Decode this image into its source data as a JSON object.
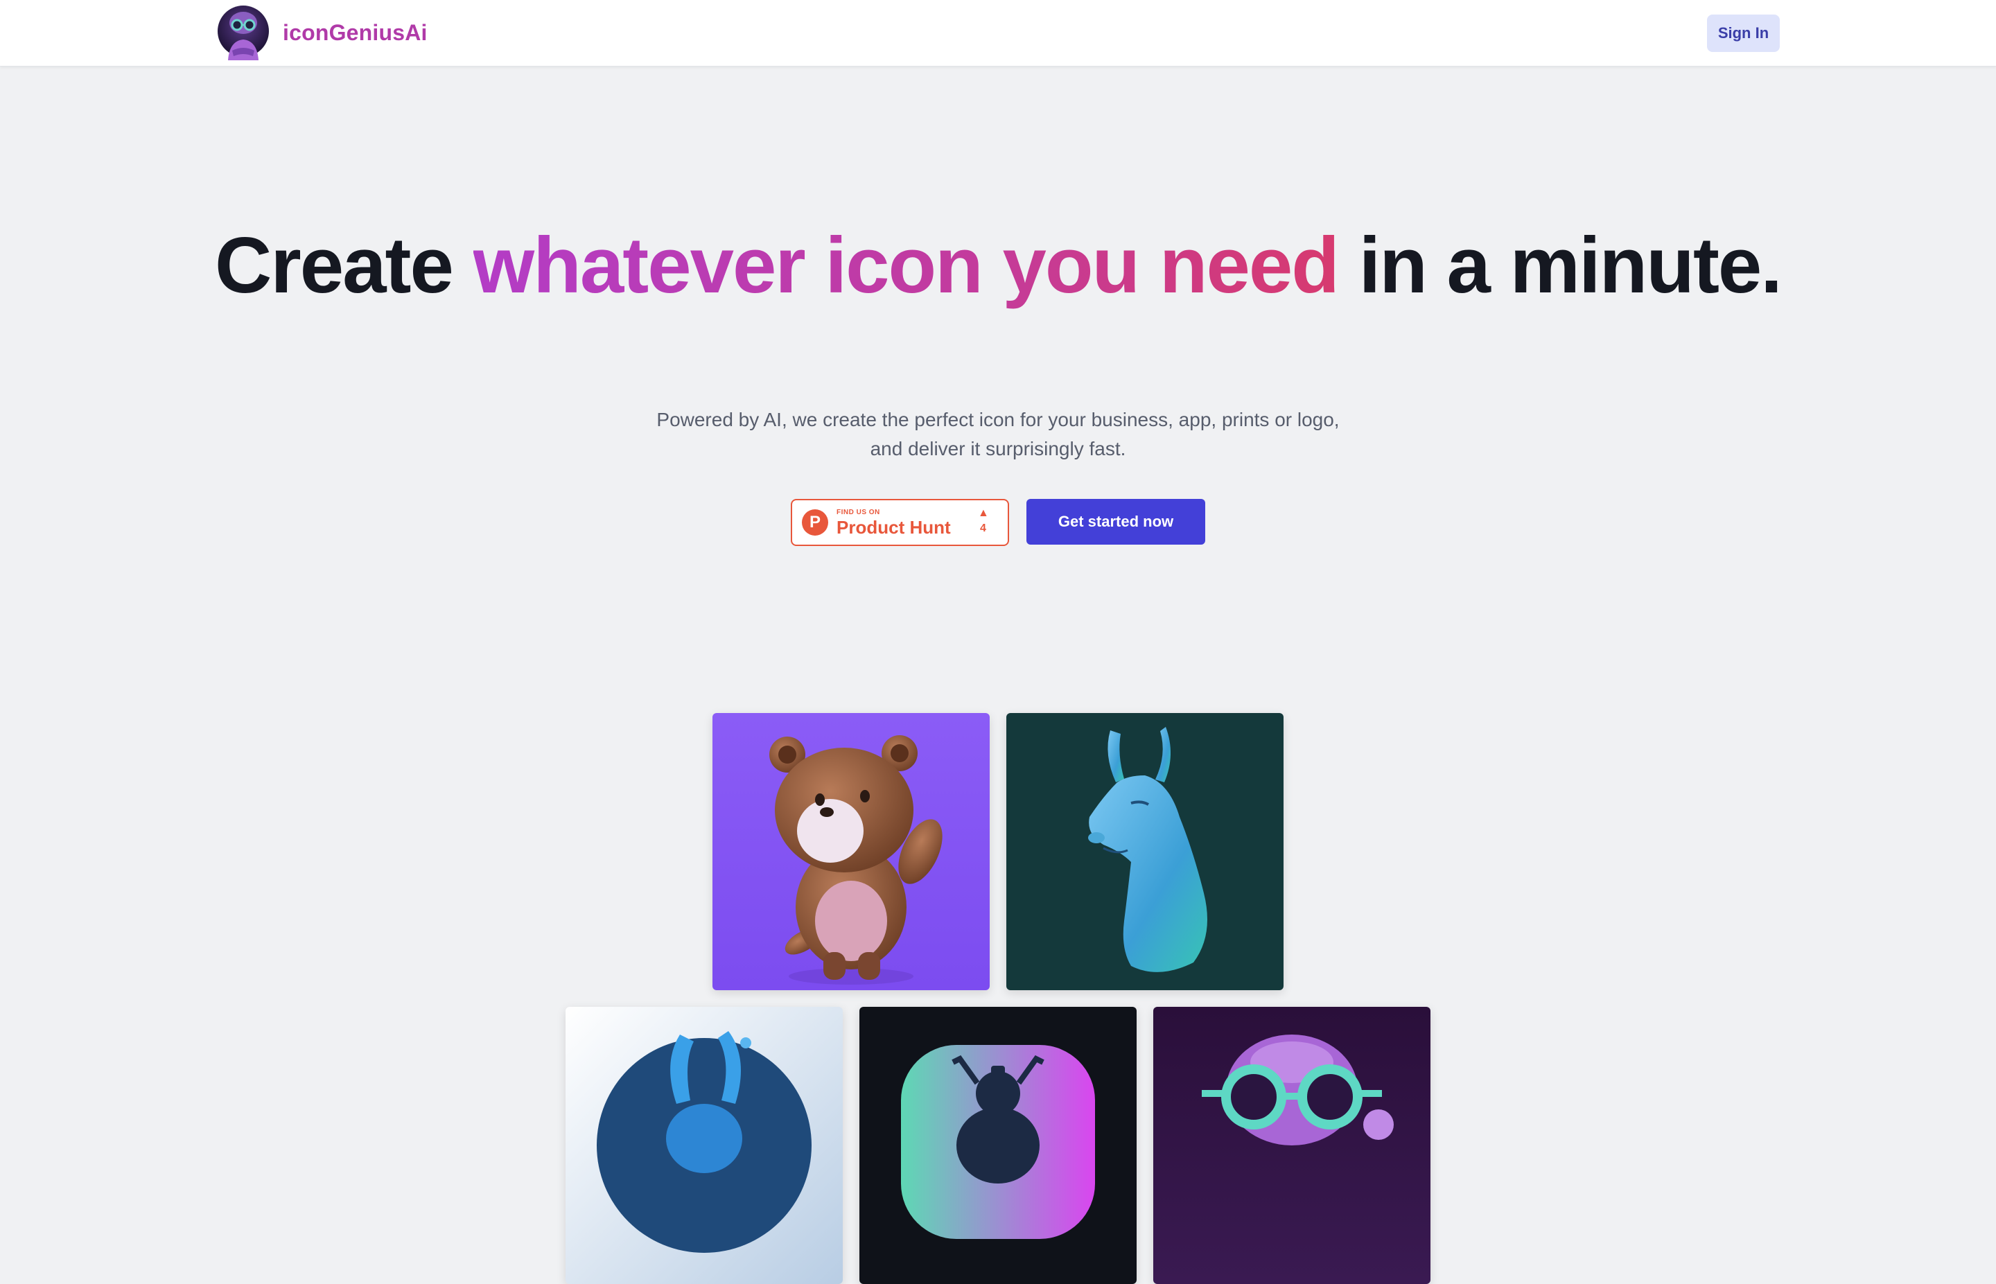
{
  "header": {
    "app_name": "iconGeniusAi",
    "logo_icon": "robot-mascot-icon",
    "sign_in_label": "Sign In"
  },
  "hero": {
    "title_part1": "Create ",
    "title_highlight": "whatever icon you need",
    "title_part2": " in a minute.",
    "subtitle": "Powered by AI, we create the perfect icon for your business, app, prints or logo, and deliver it surprisingly fast."
  },
  "product_hunt": {
    "small_text": "FIND US ON",
    "big_text": "Product Hunt",
    "upvotes": "4",
    "logo_letter": "P",
    "arrow": "▲"
  },
  "cta": {
    "label": "Get started now"
  },
  "gallery": {
    "tiles": [
      "bear-icon",
      "llama-icon",
      "rabbit-icon",
      "beetle-icon",
      "robot-glasses-icon"
    ]
  },
  "colors": {
    "brand_purple": "#b03aa8",
    "cta_blue": "#4340d8",
    "product_hunt_orange": "#e8573b",
    "background": "#f0f1f3"
  }
}
